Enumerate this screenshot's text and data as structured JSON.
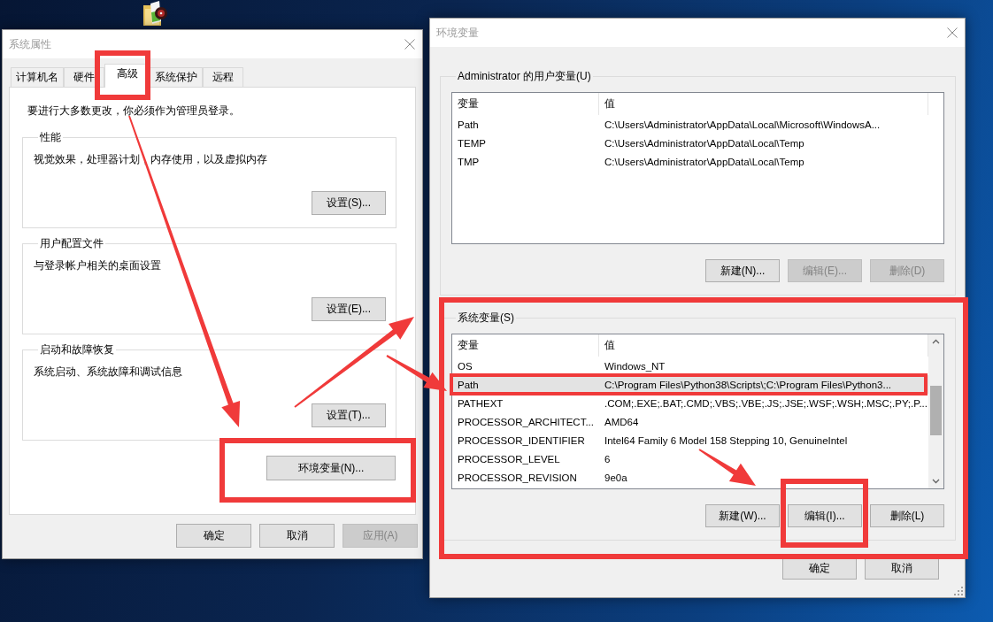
{
  "system_properties": {
    "title": "系统属性",
    "tabs": [
      {
        "label": "计算机名",
        "selected": false
      },
      {
        "label": "硬件",
        "selected": false
      },
      {
        "label": "高级",
        "selected": true
      },
      {
        "label": "系统保护",
        "selected": false
      },
      {
        "label": "远程",
        "selected": false
      }
    ],
    "notice": "要进行大多数更改，你必须作为管理员登录。",
    "groups": [
      {
        "title": "性能",
        "description": "视觉效果，处理器计划，内存使用，以及虚拟内存",
        "button": {
          "label": "设置(S)...",
          "disabled": false
        }
      },
      {
        "title": "用户配置文件",
        "description": "与登录帐户相关的桌面设置",
        "button": {
          "label": "设置(E)...",
          "disabled": false
        }
      },
      {
        "title": "启动和故障恢复",
        "description": "系统启动、系统故障和调试信息",
        "button": {
          "label": "设置(T)...",
          "disabled": false
        }
      }
    ],
    "env_button": {
      "label": "环境变量(N)...",
      "disabled": false
    },
    "buttons": [
      {
        "label": "确定",
        "disabled": false
      },
      {
        "label": "取消",
        "disabled": false
      },
      {
        "label": "应用(A)",
        "disabled": true
      }
    ]
  },
  "environment_variables": {
    "title": "环境变量",
    "user_variables": {
      "title": "Administrator 的用户变量(U)",
      "columns": [
        "变量",
        "值"
      ],
      "rows": [
        {
          "name": "Path",
          "value": "C:\\Users\\Administrator\\AppData\\Local\\Microsoft\\WindowsA...",
          "selected": false
        },
        {
          "name": "TEMP",
          "value": "C:\\Users\\Administrator\\AppData\\Local\\Temp",
          "selected": false
        },
        {
          "name": "TMP",
          "value": "C:\\Users\\Administrator\\AppData\\Local\\Temp",
          "selected": false
        }
      ],
      "buttons": [
        {
          "label": "新建(N)...",
          "disabled": false
        },
        {
          "label": "编辑(E)...",
          "disabled": true
        },
        {
          "label": "删除(D)",
          "disabled": true
        }
      ]
    },
    "system_variables": {
      "title": "系统变量(S)",
      "columns": [
        "变量",
        "值"
      ],
      "rows": [
        {
          "name": "OS",
          "value": "Windows_NT",
          "selected": false
        },
        {
          "name": "Path",
          "value": "C:\\Program Files\\Python38\\Scripts\\;C:\\Program Files\\Python3...",
          "selected": true
        },
        {
          "name": "PATHEXT",
          "value": ".COM;.EXE;.BAT;.CMD;.VBS;.VBE;.JS;.JSE;.WSF;.WSH;.MSC;.PY;.P...",
          "selected": false
        },
        {
          "name": "PROCESSOR_ARCHITECT...",
          "value": "AMD64",
          "selected": false
        },
        {
          "name": "PROCESSOR_IDENTIFIER",
          "value": "Intel64 Family 6 Model 158 Stepping 10, GenuineIntel",
          "selected": false
        },
        {
          "name": "PROCESSOR_LEVEL",
          "value": "6",
          "selected": false
        },
        {
          "name": "PROCESSOR_REVISION",
          "value": "9e0a",
          "selected": false
        }
      ],
      "buttons": [
        {
          "label": "新建(W)...",
          "disabled": false
        },
        {
          "label": "编辑(I)...",
          "disabled": false
        },
        {
          "label": "删除(L)",
          "disabled": false
        }
      ]
    },
    "buttons": [
      {
        "label": "确定",
        "disabled": false
      },
      {
        "label": "取消",
        "disabled": false
      }
    ]
  }
}
